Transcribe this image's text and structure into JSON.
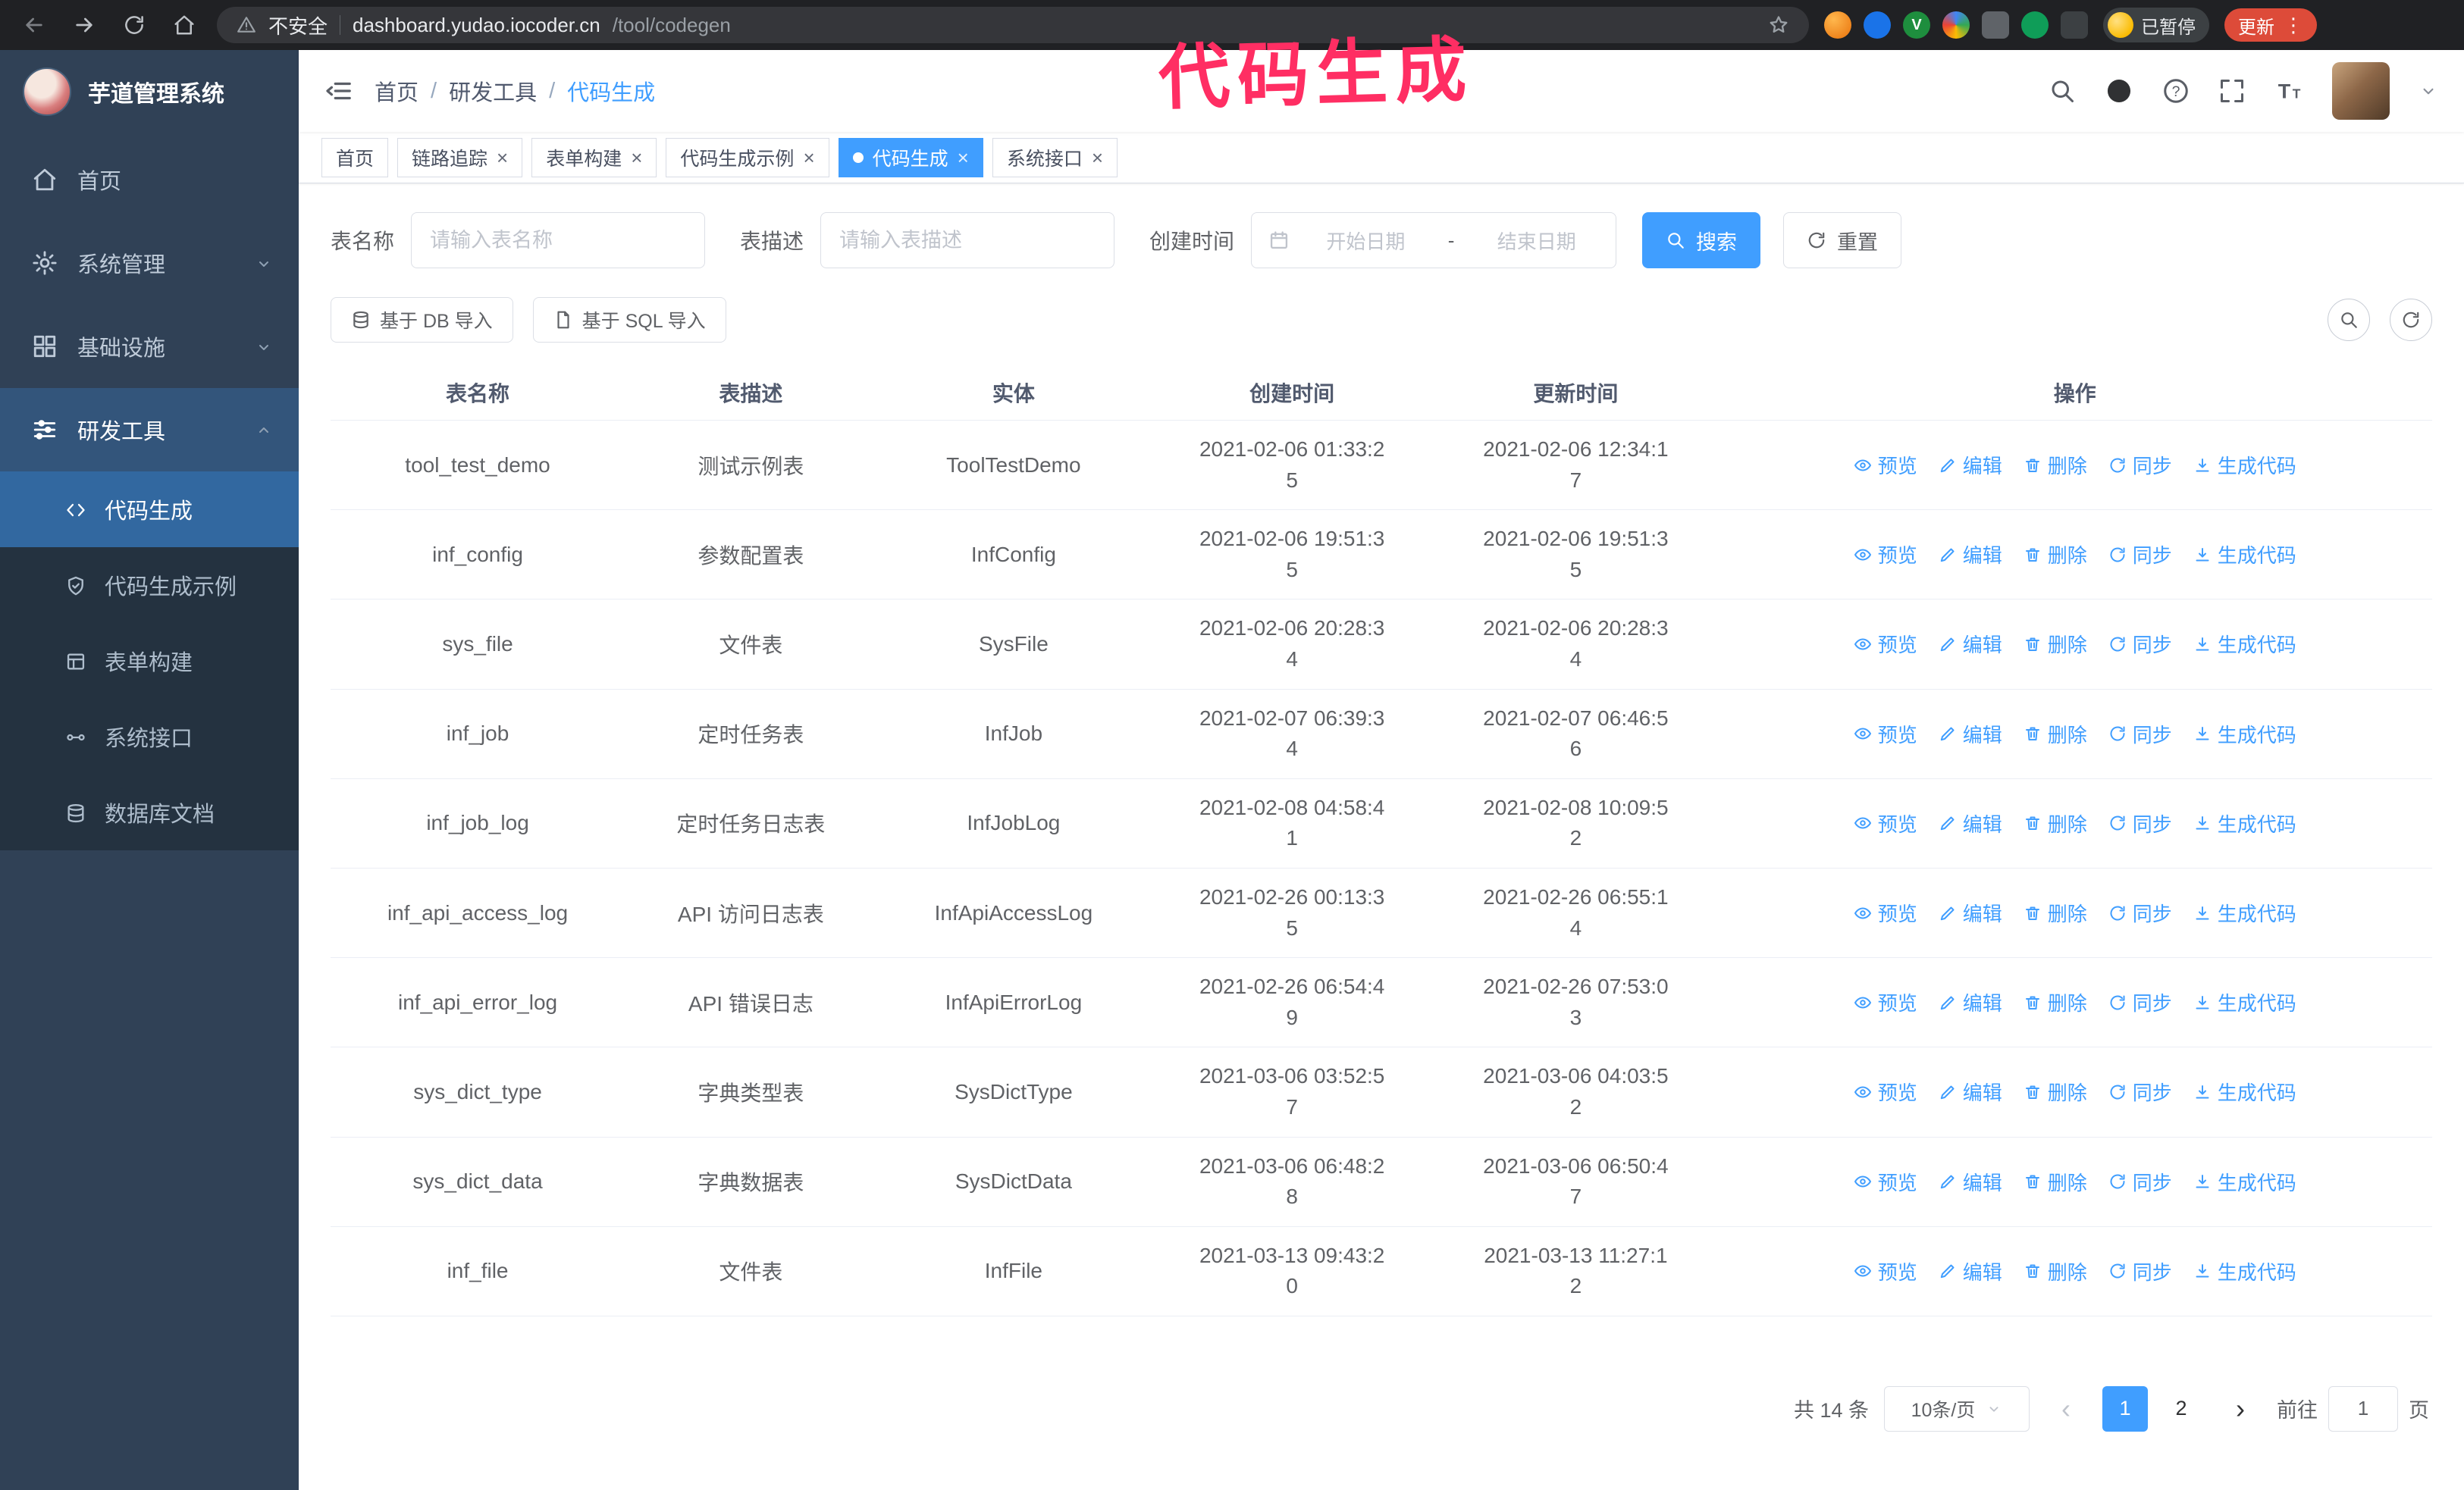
{
  "colors": {
    "primary": "#409eff",
    "annotation": "#ff2e63",
    "sidebar": "#304156"
  },
  "annotation": {
    "text": "代码生成"
  },
  "browser": {
    "security_label": "不安全",
    "url_host": "dashboard.yudao.iocoder.cn",
    "url_path": "/tool/codegen",
    "profile_badge": "已暂停",
    "update_button": "更新"
  },
  "sidebar": {
    "logo_title": "芋道管理系统",
    "items": [
      {
        "label": "首页",
        "icon": "home-icon"
      },
      {
        "label": "系统管理",
        "icon": "gear-icon",
        "chevron": "down"
      },
      {
        "label": "基础设施",
        "icon": "grid-icon",
        "chevron": "down"
      },
      {
        "label": "研发工具",
        "icon": "tools-icon",
        "chevron": "up",
        "expanded": true
      }
    ],
    "subitems": [
      {
        "label": "代码生成",
        "icon": "code-icon",
        "active": true
      },
      {
        "label": "代码生成示例",
        "icon": "shield-icon"
      },
      {
        "label": "表单构建",
        "icon": "form-icon"
      },
      {
        "label": "系统接口",
        "icon": "api-icon"
      },
      {
        "label": "数据库文档",
        "icon": "database-icon"
      }
    ]
  },
  "header": {
    "breadcrumb": [
      "首页",
      "研发工具",
      "代码生成"
    ],
    "separator": "/"
  },
  "tabs": [
    {
      "label": "首页",
      "closable": false,
      "active": false
    },
    {
      "label": "链路追踪",
      "closable": true,
      "active": false
    },
    {
      "label": "表单构建",
      "closable": true,
      "active": false
    },
    {
      "label": "代码生成示例",
      "closable": true,
      "active": false
    },
    {
      "label": "代码生成",
      "closable": true,
      "active": true
    },
    {
      "label": "系统接口",
      "closable": true,
      "active": false
    }
  ],
  "filters": {
    "table_name_label": "表名称",
    "table_name_placeholder": "请输入表名称",
    "table_desc_label": "表描述",
    "table_desc_placeholder": "请输入表描述",
    "create_time_label": "创建时间",
    "date_start_placeholder": "开始日期",
    "date_separator": "-",
    "date_end_placeholder": "结束日期",
    "search_button": "搜索",
    "reset_button": "重置"
  },
  "toolbar": {
    "import_db": "基于 DB 导入",
    "import_sql": "基于 SQL 导入"
  },
  "table": {
    "columns": [
      "表名称",
      "表描述",
      "实体",
      "创建时间",
      "更新时间",
      "操作"
    ],
    "actions": [
      "预览",
      "编辑",
      "删除",
      "同步",
      "生成代码"
    ],
    "action_icons": [
      "eye-icon",
      "edit-icon",
      "trash-icon",
      "sync-icon",
      "download-icon"
    ],
    "rows": [
      {
        "name": "tool_test_demo",
        "desc": "测试示例表",
        "entity": "ToolTestDemo",
        "created": "2021-02-06 01:33:25",
        "updated": "2021-02-06 12:34:17"
      },
      {
        "name": "inf_config",
        "desc": "参数配置表",
        "entity": "InfConfig",
        "created": "2021-02-06 19:51:35",
        "updated": "2021-02-06 19:51:35"
      },
      {
        "name": "sys_file",
        "desc": "文件表",
        "entity": "SysFile",
        "created": "2021-02-06 20:28:34",
        "updated": "2021-02-06 20:28:34"
      },
      {
        "name": "inf_job",
        "desc": "定时任务表",
        "entity": "InfJob",
        "created": "2021-02-07 06:39:34",
        "updated": "2021-02-07 06:46:56"
      },
      {
        "name": "inf_job_log",
        "desc": "定时任务日志表",
        "entity": "InfJobLog",
        "created": "2021-02-08 04:58:41",
        "updated": "2021-02-08 10:09:52"
      },
      {
        "name": "inf_api_access_log",
        "desc": "API 访问日志表",
        "entity": "InfApiAccessLog",
        "created": "2021-02-26 00:13:35",
        "updated": "2021-02-26 06:55:14"
      },
      {
        "name": "inf_api_error_log",
        "desc": "API 错误日志",
        "entity": "InfApiErrorLog",
        "created": "2021-02-26 06:54:49",
        "updated": "2021-02-26 07:53:03"
      },
      {
        "name": "sys_dict_type",
        "desc": "字典类型表",
        "entity": "SysDictType",
        "created": "2021-03-06 03:52:57",
        "updated": "2021-03-06 04:03:52"
      },
      {
        "name": "sys_dict_data",
        "desc": "字典数据表",
        "entity": "SysDictData",
        "created": "2021-03-06 06:48:28",
        "updated": "2021-03-06 06:50:47"
      },
      {
        "name": "inf_file",
        "desc": "文件表",
        "entity": "InfFile",
        "created": "2021-03-13 09:43:20",
        "updated": "2021-03-13 11:27:12"
      }
    ]
  },
  "pagination": {
    "total": "共 14 条",
    "page_size": "10条/页",
    "pages": [
      "1",
      "2"
    ],
    "active_page": "1",
    "goto_label": "前往",
    "goto_value": "1",
    "page_label": "页"
  }
}
